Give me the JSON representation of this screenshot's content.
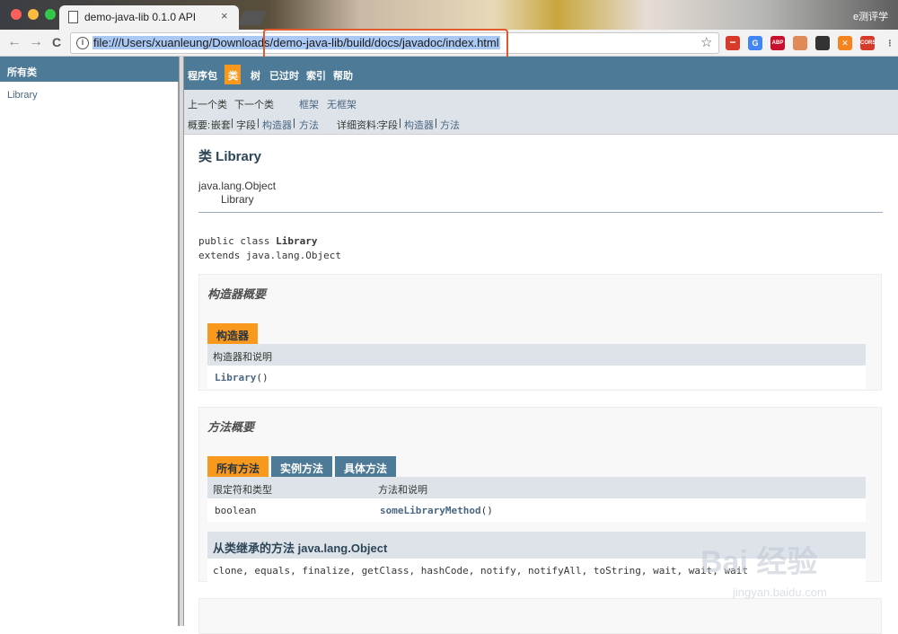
{
  "browser": {
    "tab_title": "demo-java-lib 0.1.0 API",
    "tab_close": "×",
    "user_label": "e测评学",
    "url": "file:///Users/xuanleung/Downloads/demo-java-lib/build/docs/javadoc/index.html",
    "back": "←",
    "forward": "→",
    "reload": "C",
    "star": "☆",
    "info": "i",
    "extensions": [
      {
        "name": "ext-1",
        "color": "#d63a2a",
        "label": "•••"
      },
      {
        "name": "ext-2",
        "color": "#4285f4",
        "label": "G"
      },
      {
        "name": "ext-abp",
        "color": "#c8102e",
        "label": "ABP"
      },
      {
        "name": "ext-4",
        "color": "#e08a5a",
        "label": ""
      },
      {
        "name": "ext-5",
        "color": "#333333",
        "label": ""
      },
      {
        "name": "ext-6",
        "color": "#f5831f",
        "label": "✕"
      },
      {
        "name": "ext-cors",
        "color": "#d63a2a",
        "label": "CORS"
      },
      {
        "name": "ext-menu",
        "color": "#f2f2f2",
        "label": "⋮"
      }
    ]
  },
  "left": {
    "header": "所有类",
    "items": [
      "Library"
    ]
  },
  "topnav": {
    "package": "程序包",
    "class": "类",
    "tree": "树",
    "deprecated": "已过时",
    "index": "索引",
    "help": "帮助"
  },
  "subnav": {
    "prev_class": "上一个类",
    "next_class": "下一个类",
    "frames": "框架",
    "no_frames": "无框架",
    "summary_label": "概要:",
    "summary_nested": "嵌套",
    "summary_field": "字段",
    "summary_constr": "构造器",
    "summary_method": "方法",
    "detail_label": "详细资料:",
    "detail_field": "字段",
    "detail_constr": "构造器",
    "detail_method": "方法",
    "sep": "|"
  },
  "class": {
    "title": "类 Library",
    "hierarchy_parent": "java.lang.Object",
    "hierarchy_child": "Library",
    "sig_line1_prefix": "public class ",
    "sig_line1_name": "Library",
    "sig_line2": "extends java.lang.Object"
  },
  "constructor_summary": {
    "title": "构造器概要",
    "tab": "构造器",
    "col_header": "构造器和说明",
    "row_name": "Library",
    "row_params": "()"
  },
  "method_summary": {
    "title": "方法概要",
    "tabs": [
      "所有方法",
      "实例方法",
      "具体方法"
    ],
    "col_modifier": "限定符和类型",
    "col_method": "方法和说明",
    "row_modifier": "boolean",
    "row_method": "someLibraryMethod",
    "row_params": "()",
    "inherited_title": "从类继承的方法 java.lang.Object",
    "inherited_methods": "clone, equals, finalize, getClass, hashCode, notify, notifyAll, toString, wait, wait, wait"
  },
  "watermark": {
    "text": "Bai 经验",
    "subtext": "jingyan.baidu.com"
  }
}
